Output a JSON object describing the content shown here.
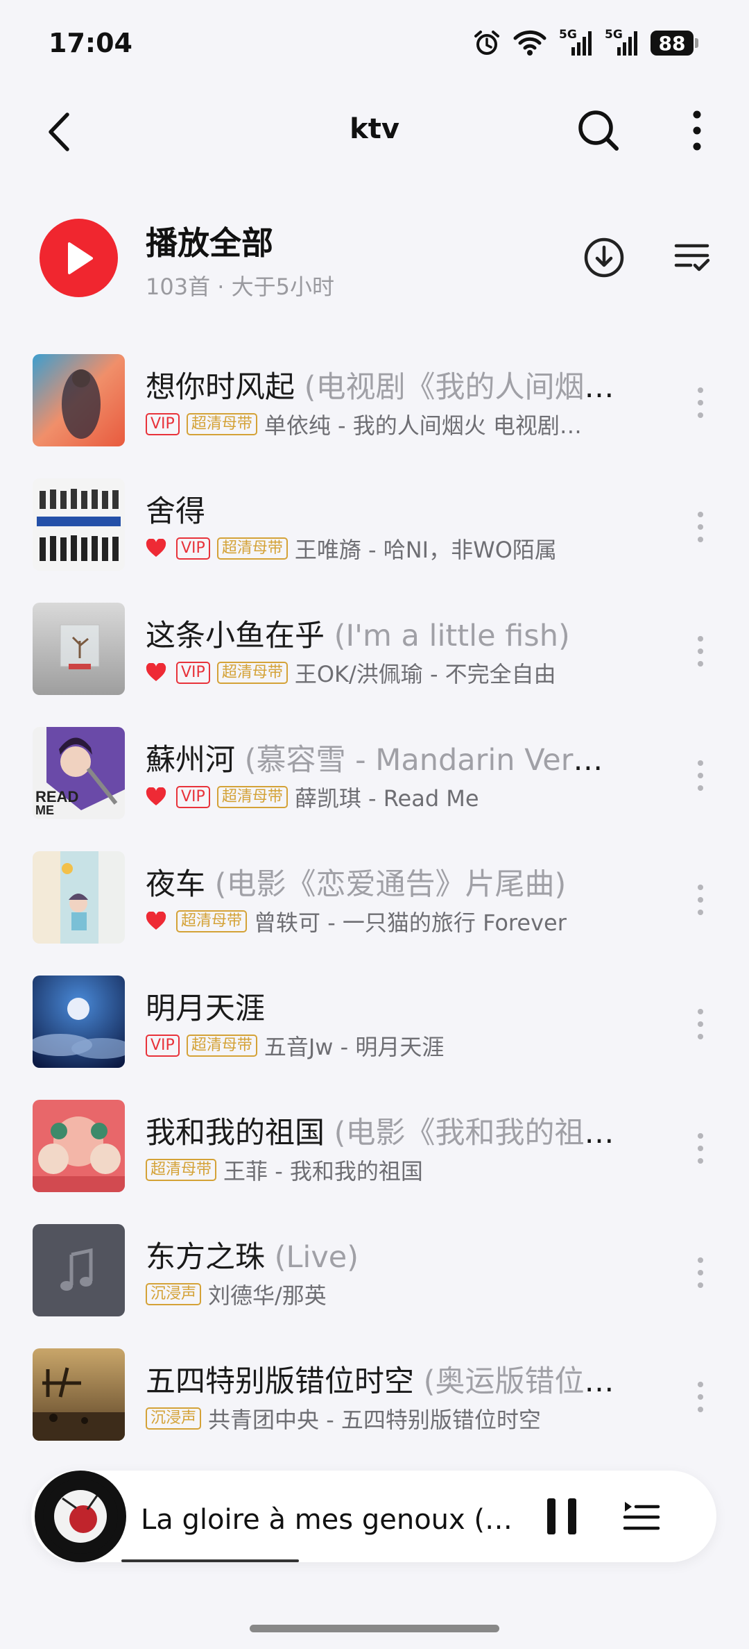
{
  "status": {
    "time": "17:04",
    "battery": "88",
    "net1": "5G",
    "net2": "5G"
  },
  "nav": {
    "title": "ktv"
  },
  "playall": {
    "title": "播放全部",
    "subtitle": "103首 · 大于5小时"
  },
  "songs": [
    {
      "title": "想你时风起",
      "subtitle": " (电视剧《我的人间烟火》片尾曲)",
      "liked": false,
      "vip": "VIP",
      "quality": "超清母带",
      "artist": "单依纯 - 我的人间烟火 电视剧原声带"
    },
    {
      "title": "舍得",
      "subtitle": "",
      "liked": true,
      "vip": "VIP",
      "quality": "超清母带",
      "artist": "王唯旖 - 哈NI，非WO陌属"
    },
    {
      "title": "这条小鱼在乎",
      "subtitle": " (I'm a little fish)",
      "liked": true,
      "vip": "VIP",
      "quality": "超清母带",
      "artist": "王OK/洪佩瑜 - 不完全自由"
    },
    {
      "title": "蘇州河",
      "subtitle": " (慕容雪 - Mandarin Version)",
      "liked": true,
      "vip": "VIP",
      "quality": "超清母带",
      "artist": "薛凯琪 - Read Me"
    },
    {
      "title": "夜车",
      "subtitle": " (电影《恋爱通告》片尾曲)",
      "liked": true,
      "vip": "",
      "quality": "超清母带",
      "artist": "曾轶可 - 一只猫的旅行 Forever"
    },
    {
      "title": "明月天涯",
      "subtitle": "",
      "liked": false,
      "vip": "VIP",
      "quality": "超清母带",
      "artist": "五音Jw - 明月天涯"
    },
    {
      "title": "我和我的祖国",
      "subtitle": " (电影《我和我的祖国》主题曲)",
      "liked": false,
      "vip": "",
      "quality": "超清母带",
      "artist": "王菲 - 我和我的祖国"
    },
    {
      "title": "东方之珠",
      "subtitle": " (Live)",
      "liked": false,
      "vip": "",
      "quality": "沉浸声",
      "artist": "刘德华/那英"
    },
    {
      "title": "五四特别版错位时空",
      "subtitle": " (奥运版错位时空)",
      "liked": false,
      "vip": "",
      "quality": "沉浸声",
      "artist": "共青团中央 - 五四特别版错位时空"
    }
  ],
  "player": {
    "title": "La gloire à mes genoux (荣耀在我膝下)",
    "progress": 0.2
  }
}
